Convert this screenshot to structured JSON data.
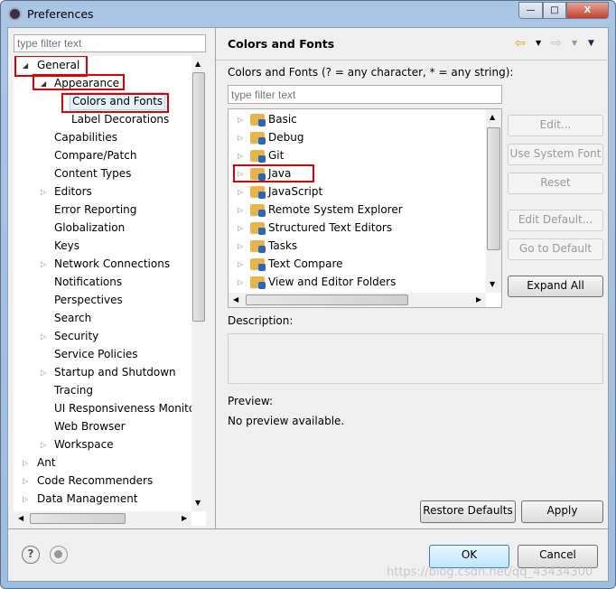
{
  "window": {
    "title": "Preferences",
    "minimize": "—",
    "maximize": "□",
    "close": "X"
  },
  "left": {
    "filter_placeholder": "type filter text",
    "tree": [
      {
        "label": "General",
        "level": 0,
        "state": "expanded"
      },
      {
        "label": "Appearance",
        "level": 1,
        "state": "expanded"
      },
      {
        "label": "Colors and Fonts",
        "level": 2,
        "state": "leaf",
        "selected": true
      },
      {
        "label": "Label Decorations",
        "level": 2,
        "state": "leaf"
      },
      {
        "label": "Capabilities",
        "level": 1,
        "state": "leaf"
      },
      {
        "label": "Compare/Patch",
        "level": 1,
        "state": "leaf"
      },
      {
        "label": "Content Types",
        "level": 1,
        "state": "leaf"
      },
      {
        "label": "Editors",
        "level": 1,
        "state": "collapsed"
      },
      {
        "label": "Error Reporting",
        "level": 1,
        "state": "leaf"
      },
      {
        "label": "Globalization",
        "level": 1,
        "state": "leaf"
      },
      {
        "label": "Keys",
        "level": 1,
        "state": "leaf"
      },
      {
        "label": "Network Connections",
        "level": 1,
        "state": "collapsed"
      },
      {
        "label": "Notifications",
        "level": 1,
        "state": "leaf"
      },
      {
        "label": "Perspectives",
        "level": 1,
        "state": "leaf"
      },
      {
        "label": "Search",
        "level": 1,
        "state": "leaf"
      },
      {
        "label": "Security",
        "level": 1,
        "state": "collapsed"
      },
      {
        "label": "Service Policies",
        "level": 1,
        "state": "leaf"
      },
      {
        "label": "Startup and Shutdown",
        "level": 1,
        "state": "collapsed"
      },
      {
        "label": "Tracing",
        "level": 1,
        "state": "leaf"
      },
      {
        "label": "UI Responsiveness Monitoring",
        "level": 1,
        "state": "leaf"
      },
      {
        "label": "Web Browser",
        "level": 1,
        "state": "leaf"
      },
      {
        "label": "Workspace",
        "level": 1,
        "state": "collapsed"
      },
      {
        "label": "Ant",
        "level": 0,
        "state": "collapsed"
      },
      {
        "label": "Code Recommenders",
        "level": 0,
        "state": "collapsed"
      },
      {
        "label": "Data Management",
        "level": 0,
        "state": "collapsed"
      }
    ]
  },
  "right": {
    "title": "Colors and Fonts",
    "filter_label": "Colors and Fonts (? = any character, * = any string):",
    "filter_placeholder": "type filter text",
    "items": [
      "Basic",
      "Debug",
      "Git",
      "Java",
      "JavaScript",
      "Remote System Explorer",
      "Structured Text Editors",
      "Tasks",
      "Text Compare",
      "View and Editor Folders"
    ],
    "buttons": {
      "edit": "Edit...",
      "use_system_font": "Use System Font",
      "reset": "Reset",
      "edit_default": "Edit Default...",
      "go_to_default": "Go to Default",
      "expand_all": "Expand All"
    },
    "description_label": "Description:",
    "preview_label": "Preview:",
    "preview_text": "No preview available.",
    "restore_defaults": "Restore Defaults",
    "apply": "Apply"
  },
  "footer": {
    "ok": "OK",
    "cancel": "Cancel",
    "help": "?"
  },
  "watermark": "https://blog.csdn.net/qq_43434300",
  "colors": {
    "highlight": "#e00000",
    "selection": "#e5f3fb",
    "ok_border": "#3c7fb1"
  }
}
